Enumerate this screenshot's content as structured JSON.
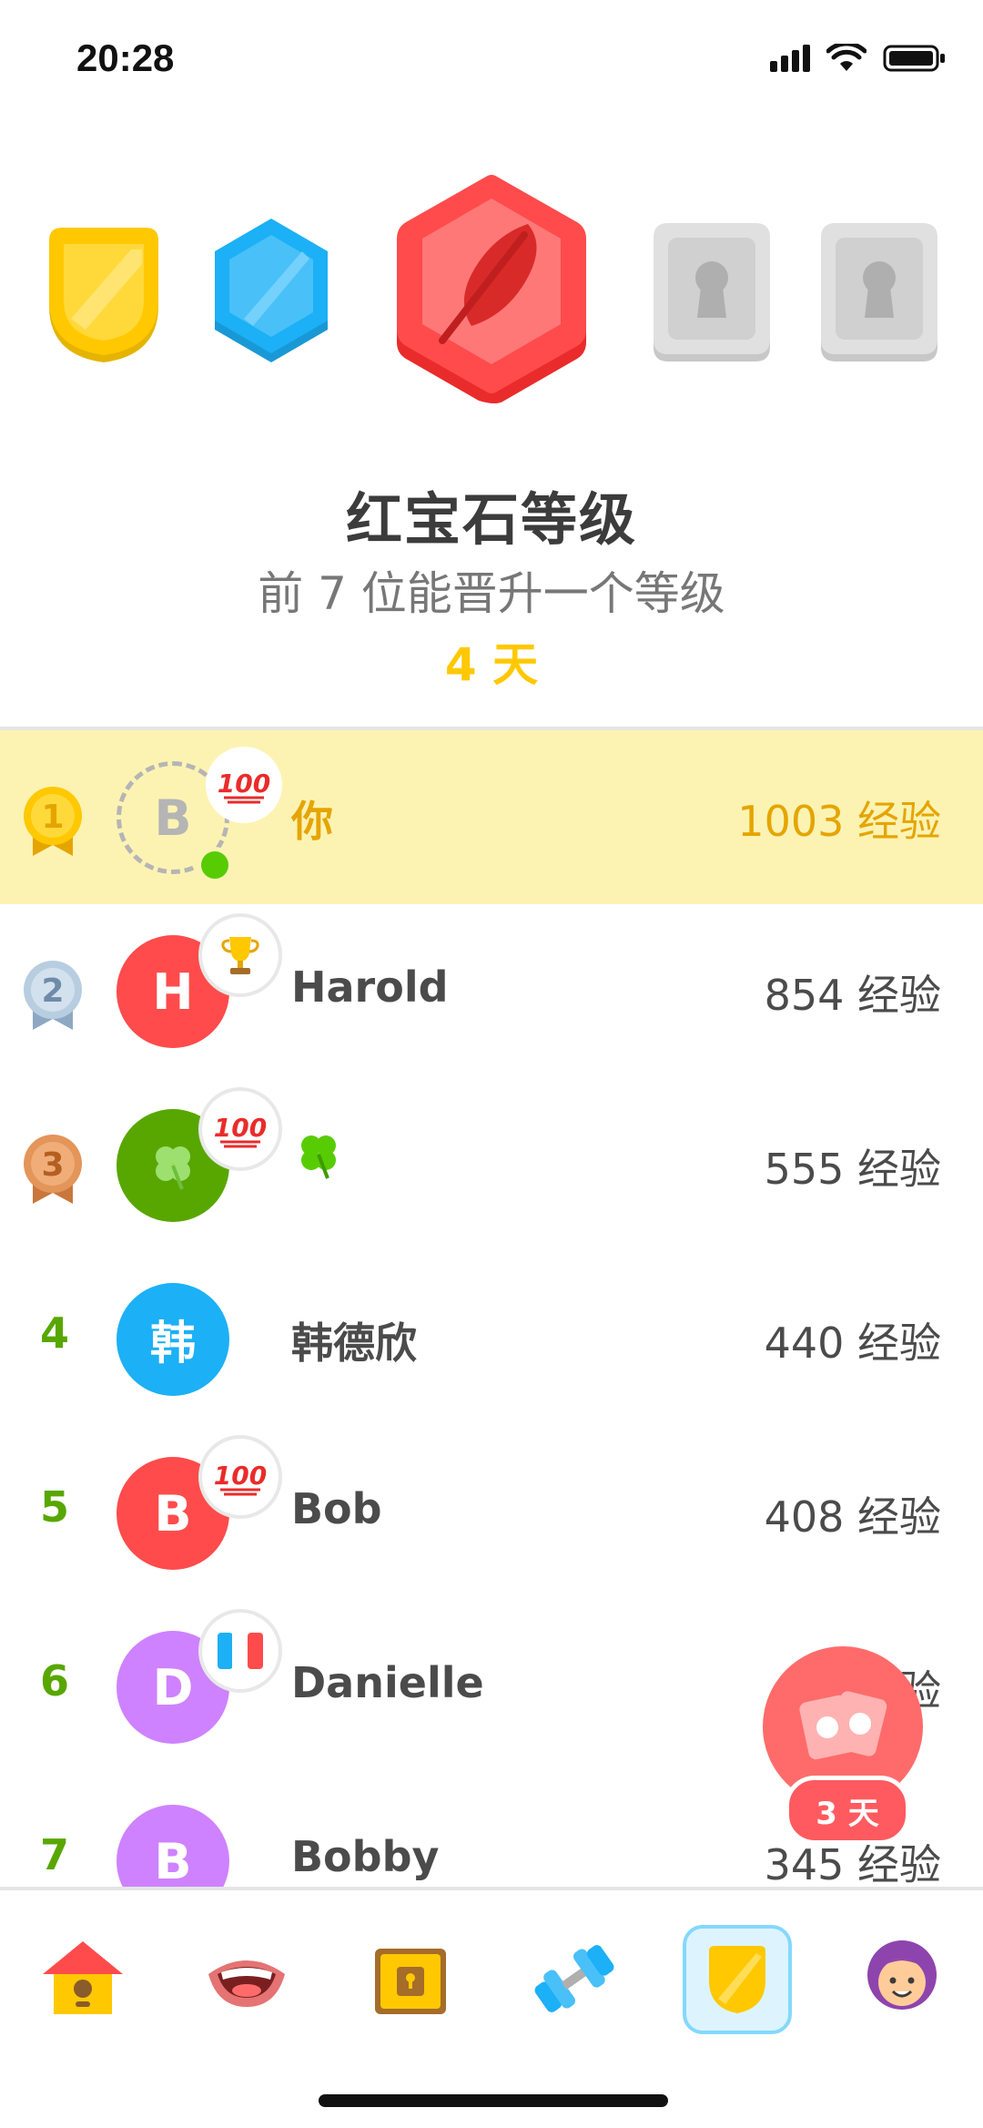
{
  "status_bar": {
    "time": "20:28"
  },
  "league": {
    "title": "红宝石等级",
    "subtitle": "前 7 位能晋升一个等级",
    "countdown": "4 天"
  },
  "badges": [
    "gold",
    "sapphire",
    "ruby",
    "locked",
    "locked"
  ],
  "rows": [
    {
      "rank": "1",
      "avatar_letter": "B",
      "name": "你",
      "xp": "1003 经验",
      "badge": "hundred-icon"
    },
    {
      "rank": "2",
      "avatar_letter": "H",
      "name": "Harold",
      "xp": "854 经验",
      "badge": "trophy-icon"
    },
    {
      "rank": "3",
      "avatar_letter": "🍀",
      "name": "🍀",
      "xp": "555 经验",
      "badge": "hundred-icon"
    },
    {
      "rank": "4",
      "avatar_letter": "韩",
      "name": "韩德欣",
      "xp": "440 经验",
      "badge": ""
    },
    {
      "rank": "5",
      "avatar_letter": "B",
      "name": "Bob",
      "xp": "408 经验",
      "badge": "hundred-icon"
    },
    {
      "rank": "6",
      "avatar_letter": "D",
      "name": "Danielle",
      "xp": "3 经验",
      "badge": "france-flag-icon"
    },
    {
      "rank": "7",
      "avatar_letter": "B",
      "name": "Bobby",
      "xp": "345 经验",
      "badge": ""
    }
  ],
  "fab": {
    "label": "3 天"
  },
  "colors": {
    "self_highlight": "#fcf3b3",
    "gold_text": "#e5a500",
    "rank_green": "#58a700",
    "ruby": "#ff4b4b",
    "sapphire": "#1cb0f6"
  }
}
